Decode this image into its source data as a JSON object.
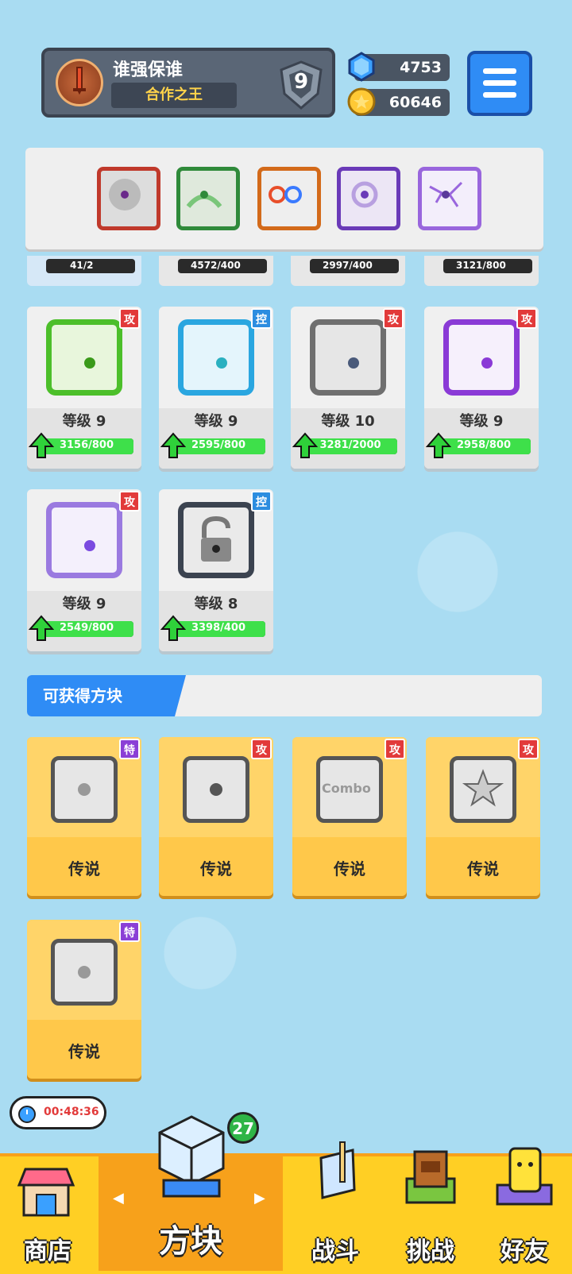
{
  "header": {
    "player_name": "谁强保谁",
    "player_title": "合作之王",
    "rank": "9",
    "gems": "4753",
    "coins": "60646"
  },
  "equipped": {
    "icons": [
      "saw-dice-icon",
      "wind-dice-icon",
      "combo-dice-icon",
      "spiral-dice-icon",
      "crack-dice-icon"
    ]
  },
  "partial_cards": [
    "41/2",
    "4572/400",
    "2997/400",
    "3121/800"
  ],
  "dice_cards": [
    {
      "name": "acid-dice",
      "tag": "攻",
      "level": "等级 9",
      "progress": "3156/800",
      "progress_fraction": 1
    },
    {
      "name": "ice-dice",
      "tag": "控",
      "level": "等级 9",
      "progress": "2595/800",
      "progress_fraction": 1
    },
    {
      "name": "gear-dice",
      "tag": "攻",
      "level": "等级 10",
      "progress": "3281/2000",
      "progress_fraction": 1
    },
    {
      "name": "arrow-dice",
      "tag": "攻",
      "level": "等级 9",
      "progress": "2958/800",
      "progress_fraction": 1
    },
    {
      "name": "mystery-dice",
      "tag": "攻",
      "level": "等级 9",
      "progress": "2549/800",
      "progress_fraction": 1
    },
    {
      "name": "lock-dice",
      "tag": "控",
      "level": "等级 8",
      "progress": "3398/400",
      "progress_fraction": 1
    }
  ],
  "available_section": {
    "title": "可获得方块"
  },
  "legend_cards": [
    {
      "tag": "特",
      "rarity": "传说"
    },
    {
      "tag": "攻",
      "rarity": "传说"
    },
    {
      "tag": "攻",
      "rarity": "传说",
      "face_text": "Combo"
    },
    {
      "tag": "攻",
      "rarity": "传说"
    },
    {
      "tag": "特",
      "rarity": "传说"
    }
  ],
  "timer": "00:48:36",
  "nav": {
    "shop": "商店",
    "dice": "方块",
    "dice_badge": "27",
    "battle": "战斗",
    "challenge": "挑战",
    "friends": "好友",
    "prev_arrow": "◀",
    "next_arrow": "▶"
  }
}
